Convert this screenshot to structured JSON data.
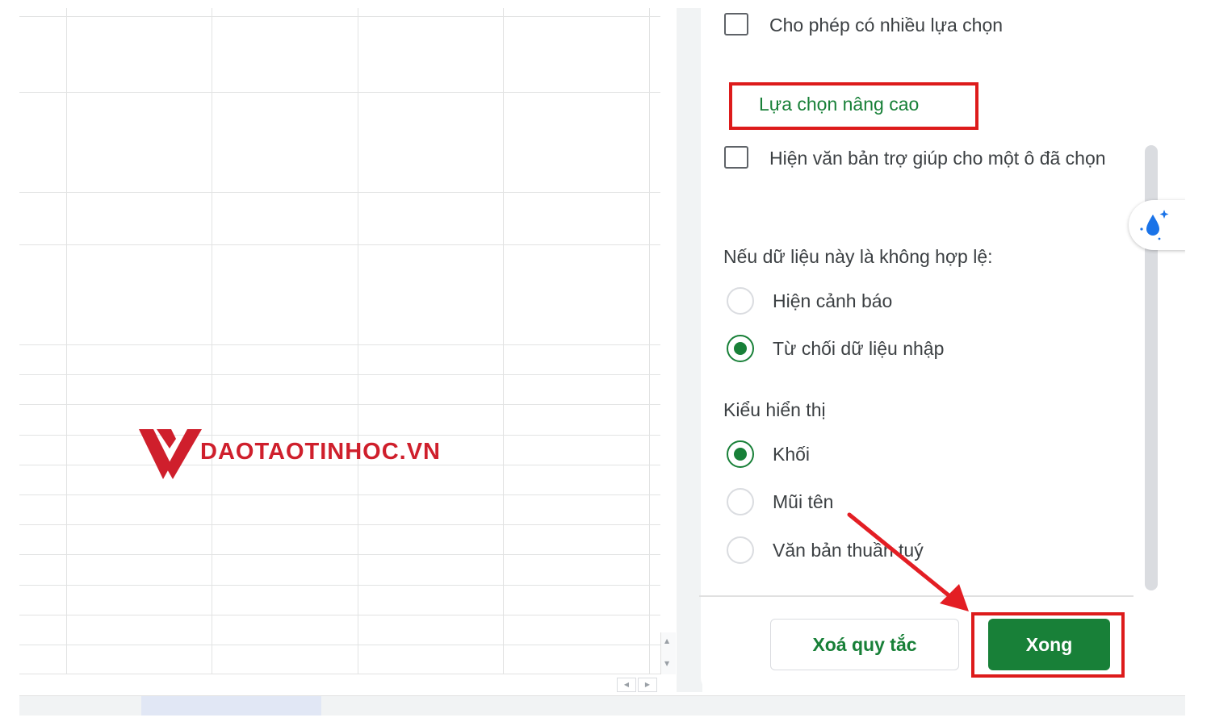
{
  "watermark": {
    "text": "DAOTAOTINHOC.VN",
    "color": "#cf1f2c"
  },
  "panel": {
    "allow_multiple_label": "Cho phép có nhiều lựa chọn",
    "advanced_options_label": "Lựa chọn nâng cao",
    "help_text_label": "Hiện văn bản trợ giúp cho một ô đã chọn",
    "invalid_data_heading": "Nếu dữ liệu này là không hợp lệ:",
    "invalid_options": [
      {
        "label": "Hiện cảnh báo",
        "selected": false
      },
      {
        "label": "Từ chối dữ liệu nhập",
        "selected": true
      }
    ],
    "display_style_heading": "Kiểu hiển thị",
    "display_options": [
      {
        "label": "Khối",
        "selected": true
      },
      {
        "label": "Mũi tên",
        "selected": false
      },
      {
        "label": "Văn bản thuần tuý",
        "selected": false
      }
    ],
    "clear_button": "Xoá quy tắc",
    "done_button": "Xong"
  },
  "colors": {
    "accent_green": "#188038",
    "highlight_red": "#dd1b1b"
  },
  "icons": {
    "sparkle_drop": "sparkle-drop-icon",
    "scroll_up": "scroll-up-arrow-icon",
    "scroll_down": "scroll-down-arrow-icon",
    "scroll_left": "scroll-left-arrow-icon",
    "scroll_right": "scroll-right-arrow-icon",
    "annotation_arrow": "red-arrow-icon"
  }
}
